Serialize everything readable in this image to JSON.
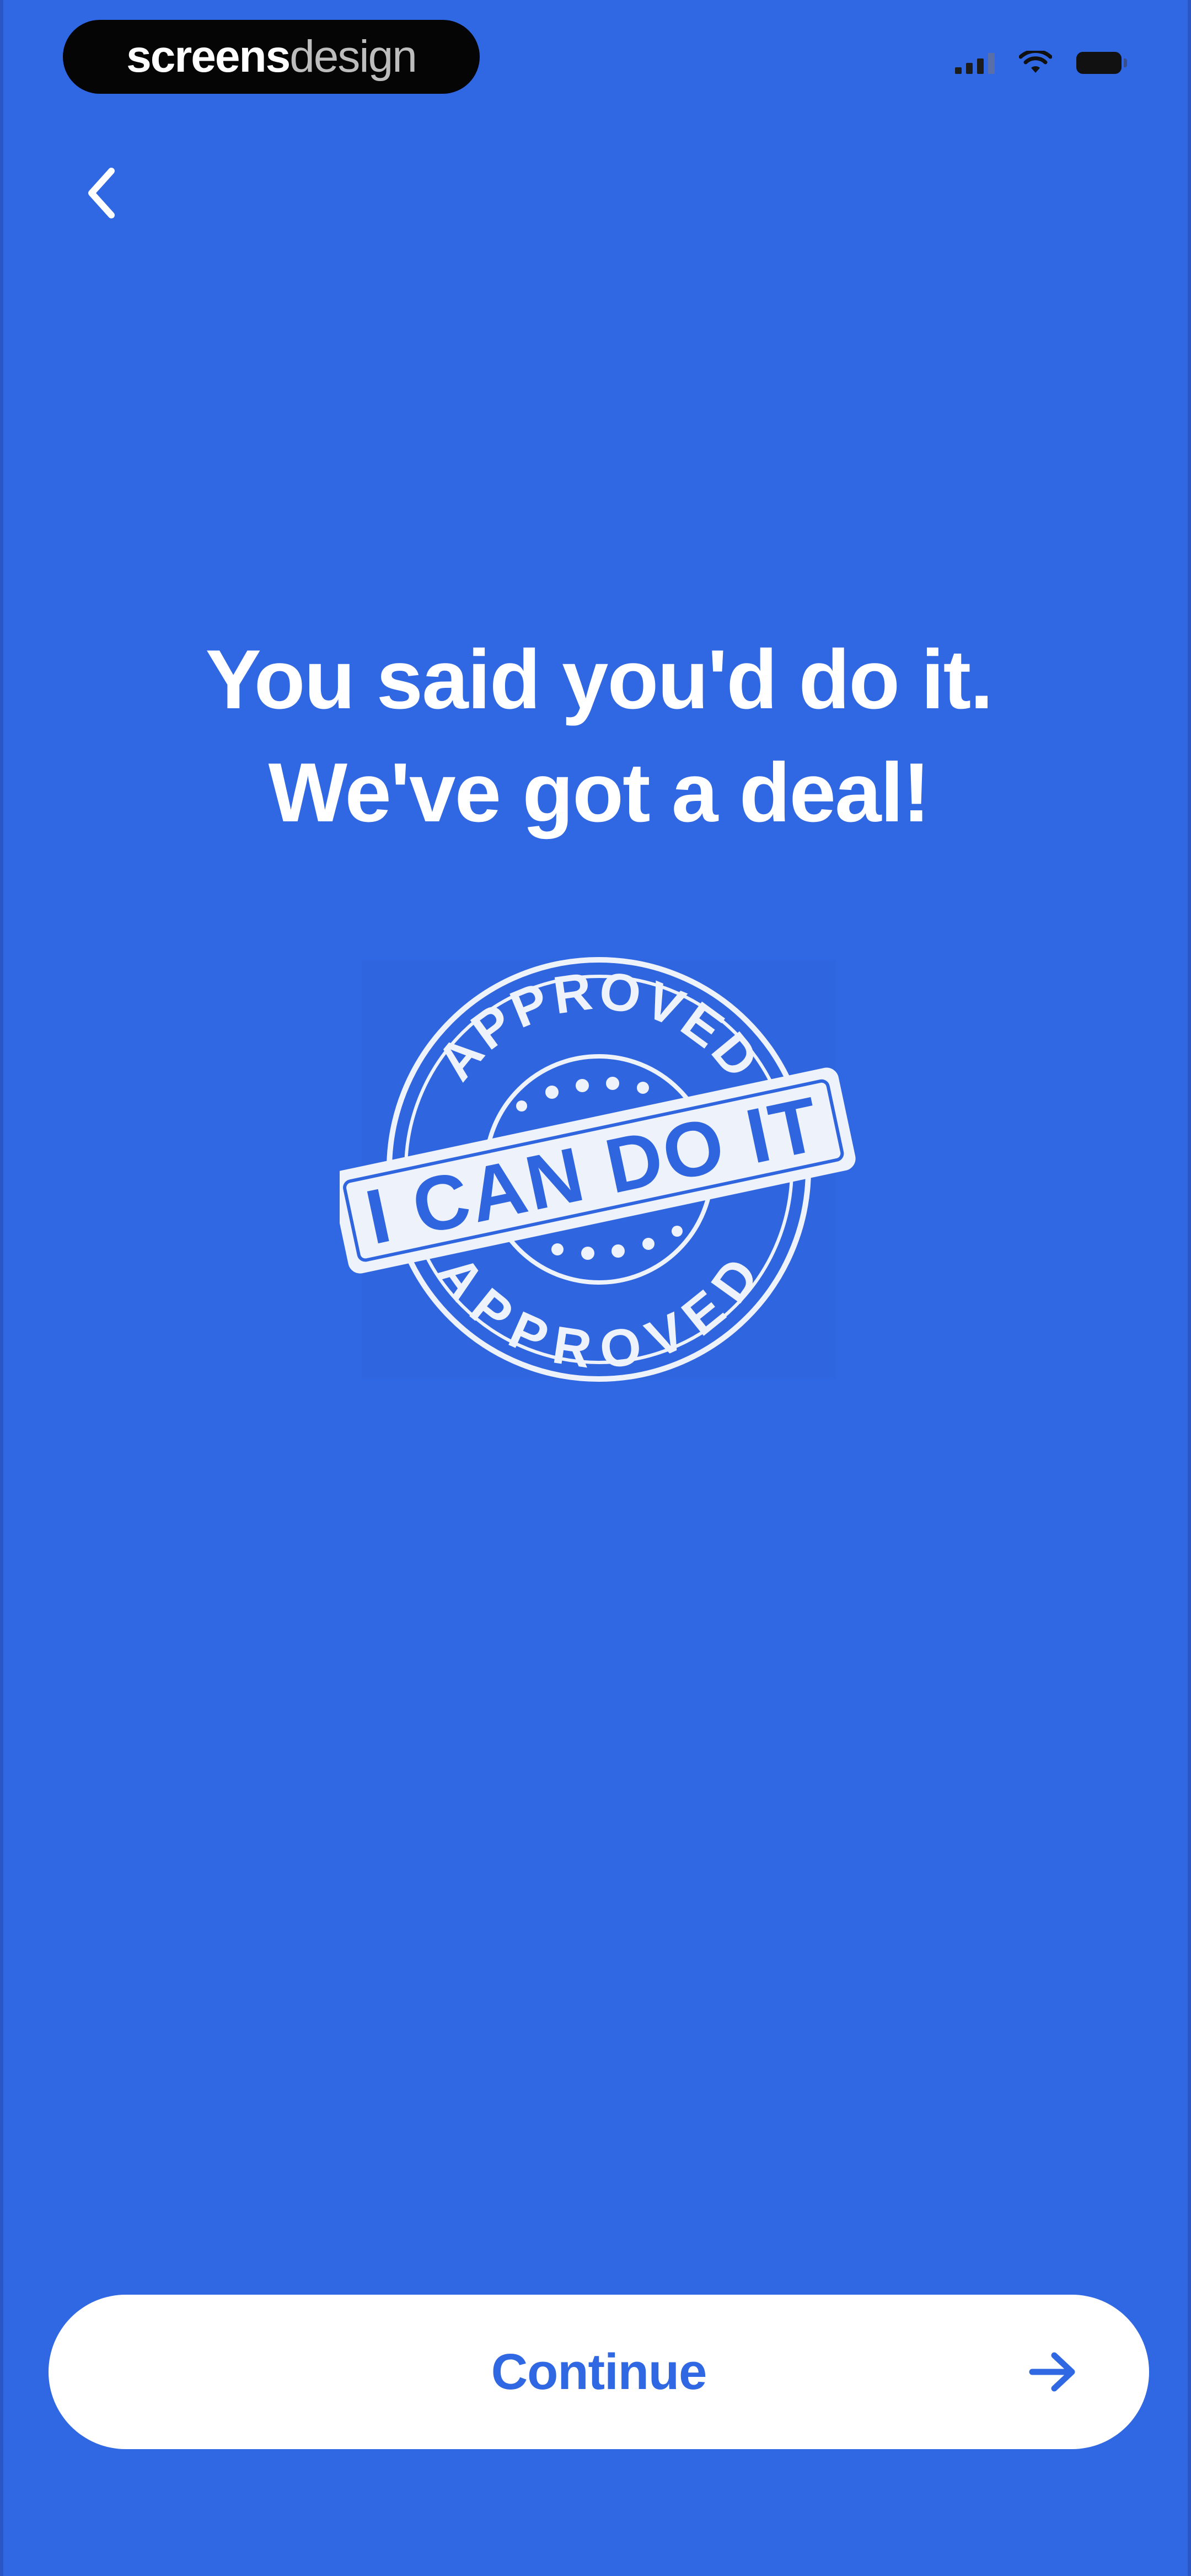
{
  "status_bar": {
    "brand_bold": "screens",
    "brand_light": "design",
    "signal_icon": "signal-icon",
    "wifi_icon": "wifi-icon",
    "battery_icon": "battery-icon"
  },
  "nav": {
    "back_icon": "chevron-left-icon"
  },
  "headline": {
    "line1": "You said you'd do it.",
    "line2": "We've got a deal!"
  },
  "stamp": {
    "top_arc": "APPROVED",
    "center": "I CAN DO IT",
    "bottom_arc": "APPROVED"
  },
  "footer": {
    "continue_label": "Continue",
    "continue_icon": "arrow-right-icon"
  },
  "colors": {
    "background": "#3067E3",
    "button_bg": "#FFFFFF",
    "button_text": "#3067E3",
    "text": "#FFFFFF"
  }
}
